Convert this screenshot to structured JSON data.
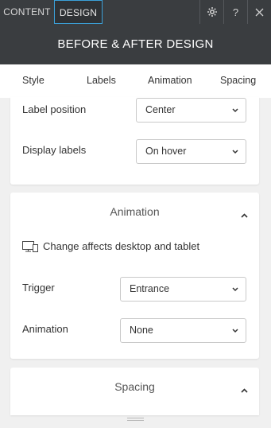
{
  "tabs": {
    "content": "CONTENT",
    "design": "DESIGN"
  },
  "header": {
    "title": "BEFORE & AFTER DESIGN"
  },
  "top_icons": [
    "gear-icon",
    "help-icon",
    "close-icon"
  ],
  "top_icon_glyphs": {
    "help": "?"
  },
  "subnav": {
    "items": [
      "Style",
      "Labels",
      "Animation",
      "Spacing"
    ],
    "active": "Labels"
  },
  "labels_section": {
    "label_position": {
      "label": "Label position",
      "value": "Center"
    },
    "display_labels": {
      "label": "Display labels",
      "value": "On hover"
    }
  },
  "animation_section": {
    "title": "Animation",
    "device_note": "Change affects desktop and tablet",
    "trigger": {
      "label": "Trigger",
      "value": "Entrance"
    },
    "animation": {
      "label": "Animation",
      "value": "None"
    }
  },
  "spacing_section": {
    "title": "Spacing"
  },
  "colors": {
    "dark_bar": "#3a3d40",
    "accent": "#3ba0d8",
    "background": "#f0f0f0"
  }
}
